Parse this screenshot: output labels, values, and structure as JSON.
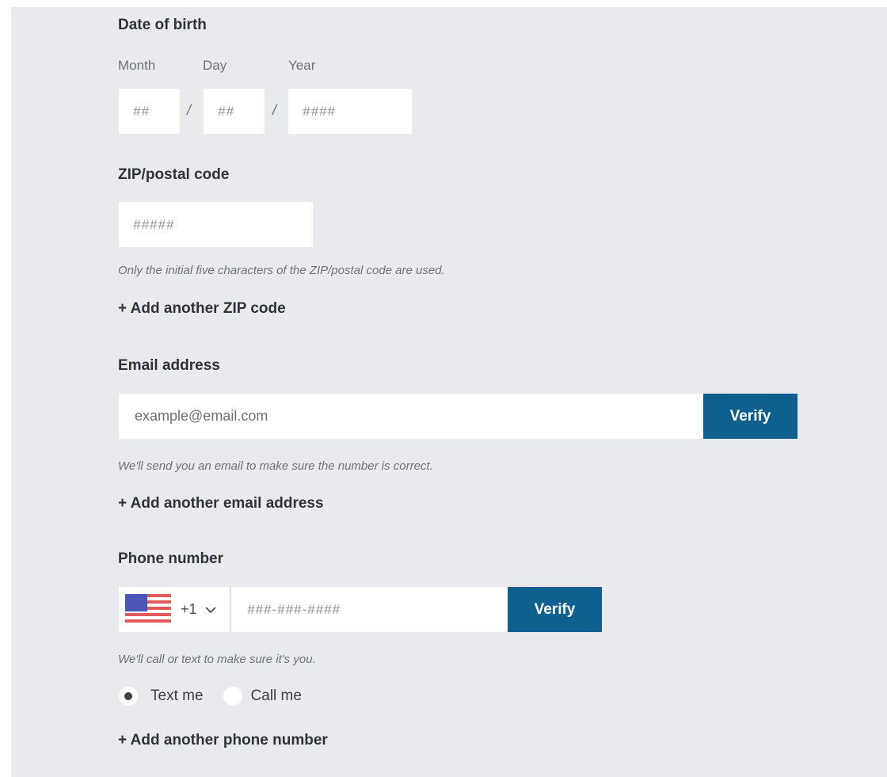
{
  "dob": {
    "label": "Date of birth",
    "month_label": "Month",
    "day_label": "Day",
    "year_label": "Year",
    "month_placeholder": "##",
    "day_placeholder": "##",
    "year_placeholder": "####",
    "separator": "/"
  },
  "zip": {
    "label": "ZIP/postal code",
    "placeholder": "#####",
    "hint": "Only the initial five characters of the ZIP/postal code are used.",
    "add_link": "+ Add another ZIP code"
  },
  "email": {
    "label": "Email address",
    "placeholder": "example@email.com",
    "verify_label": "Verify",
    "hint": "We'll send you an email to make sure the number is correct.",
    "add_link": "+ Add another email address"
  },
  "phone": {
    "label": "Phone number",
    "country_code": "+1",
    "country_flag": "us-flag-icon",
    "placeholder": "###-###-####",
    "verify_label": "Verify",
    "hint": "We'll call or text to make sure it's you.",
    "options": [
      {
        "label": "Text me",
        "selected": true
      },
      {
        "label": "Call me",
        "selected": false
      }
    ],
    "add_link": "+ Add another phone number"
  },
  "colors": {
    "background": "#e8eaed",
    "accent": "#0f5f8f",
    "text": "#2f3339"
  }
}
